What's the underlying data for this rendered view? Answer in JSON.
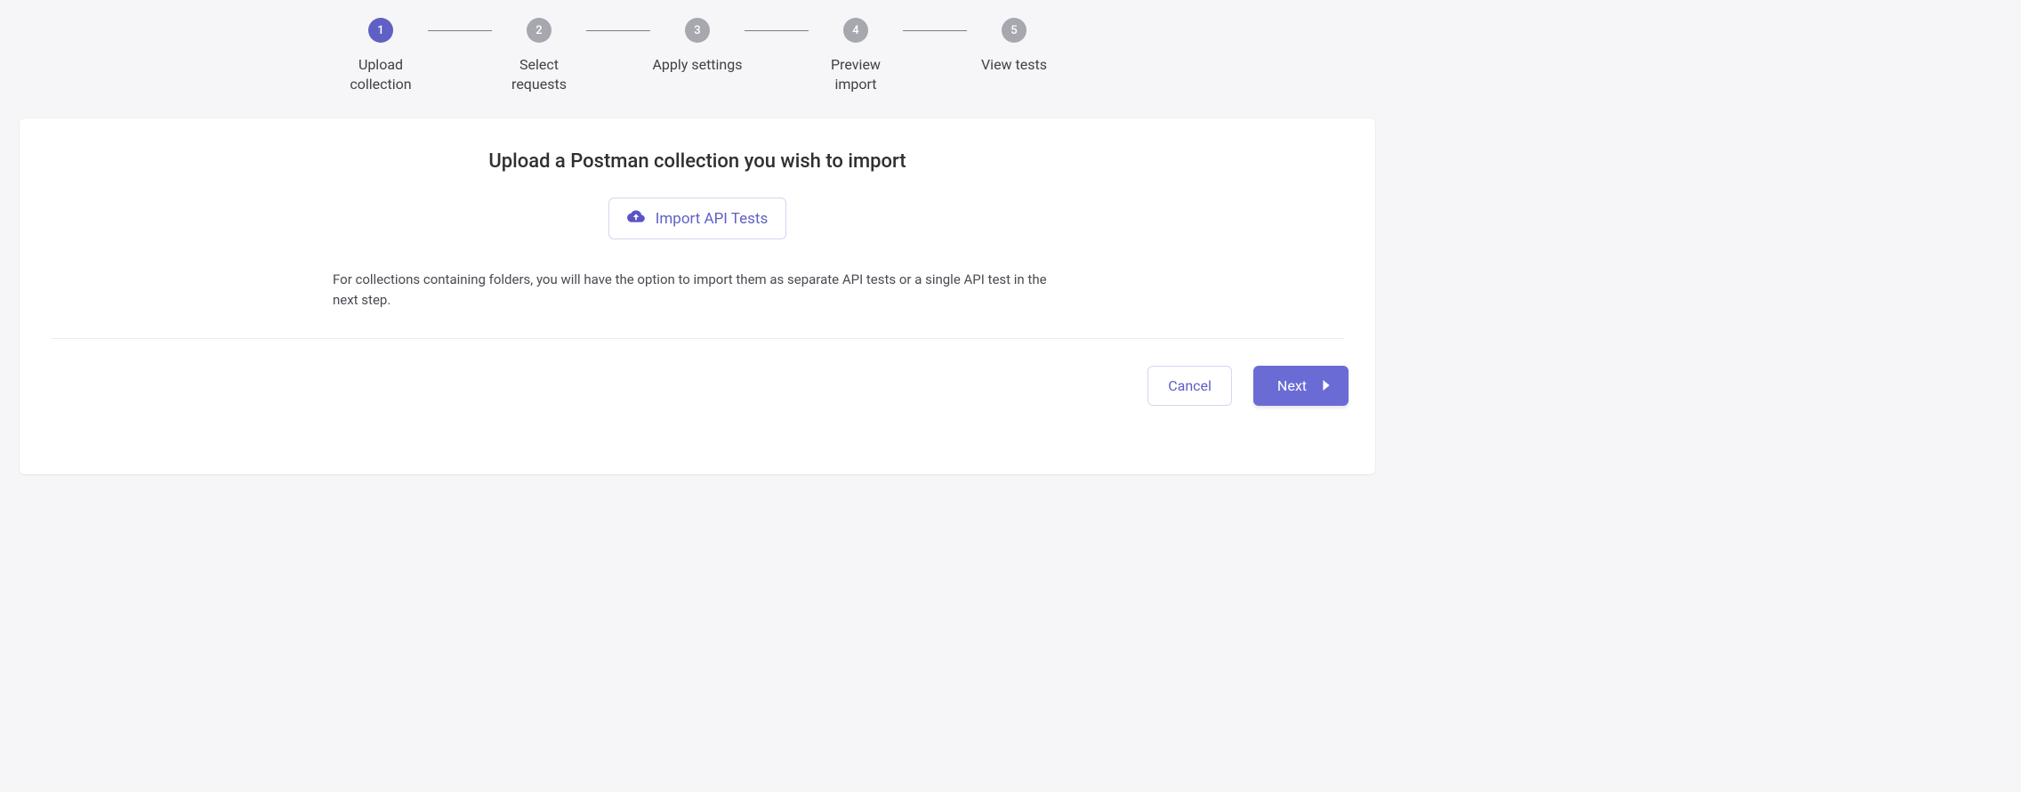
{
  "stepper": [
    {
      "num": "1",
      "label": "Upload collection",
      "active": true
    },
    {
      "num": "2",
      "label": "Select requests",
      "active": false
    },
    {
      "num": "3",
      "label": "Apply settings",
      "active": false
    },
    {
      "num": "4",
      "label": "Preview import",
      "active": false
    },
    {
      "num": "5",
      "label": "View tests",
      "active": false
    }
  ],
  "card": {
    "heading": "Upload a Postman collection you wish to import",
    "importLabel": "Import API Tests",
    "helper": "For collections containing folders, you will have the option to import them as separate API tests or a single API test in the next step."
  },
  "footer": {
    "cancel": "Cancel",
    "next": "Next"
  }
}
